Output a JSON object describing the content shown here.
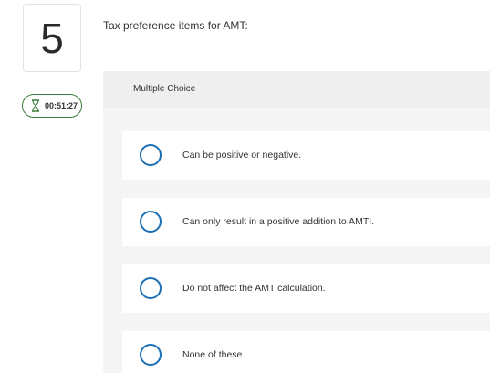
{
  "question": {
    "number": "5",
    "prompt": "Tax preference items for AMT:",
    "type_label": "Multiple Choice"
  },
  "timer": {
    "icon": "hourglass-icon",
    "value": "00:51:27"
  },
  "choices": [
    {
      "label": "Can be positive or negative.",
      "selected": false
    },
    {
      "label": "Can only result in a positive addition to AMTI.",
      "selected": false
    },
    {
      "label": "Do not affect the AMT calculation.",
      "selected": false
    },
    {
      "label": "None of these.",
      "selected": false
    }
  ],
  "colors": {
    "radio_border": "#1a6fb5",
    "timer_border": "#3d7a3d",
    "panel_background": "#f5f5f5"
  }
}
